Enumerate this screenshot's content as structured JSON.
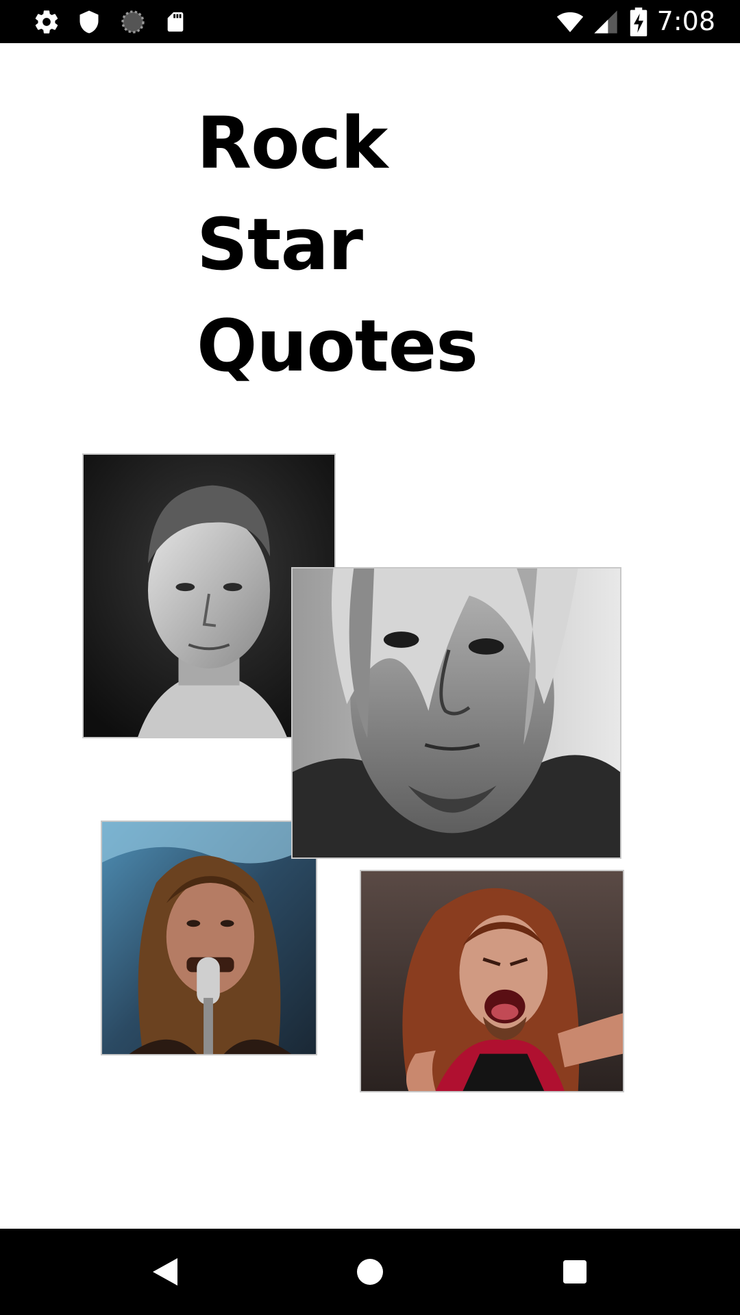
{
  "status_bar": {
    "time": "7:08",
    "left_icons": [
      "gear-icon",
      "shield-icon",
      "sync-icon",
      "sd-card-icon"
    ],
    "right_icons": [
      "wifi-icon",
      "signal-icon",
      "battery-charging-icon"
    ]
  },
  "title": {
    "lines": [
      "Rock",
      "Star",
      "Quotes"
    ]
  },
  "collage": {
    "photos": [
      {
        "name": "portrait-short-hair",
        "tone": "grayscale"
      },
      {
        "name": "portrait-long-fringe",
        "tone": "grayscale"
      },
      {
        "name": "portrait-microphone",
        "tone": "color"
      },
      {
        "name": "portrait-shouting",
        "tone": "color"
      }
    ]
  },
  "nav_bar": {
    "buttons": [
      "back-icon",
      "home-icon",
      "recents-icon"
    ]
  },
  "colors": {
    "bars": "#000000",
    "background": "#ffffff",
    "text": "#000000"
  }
}
